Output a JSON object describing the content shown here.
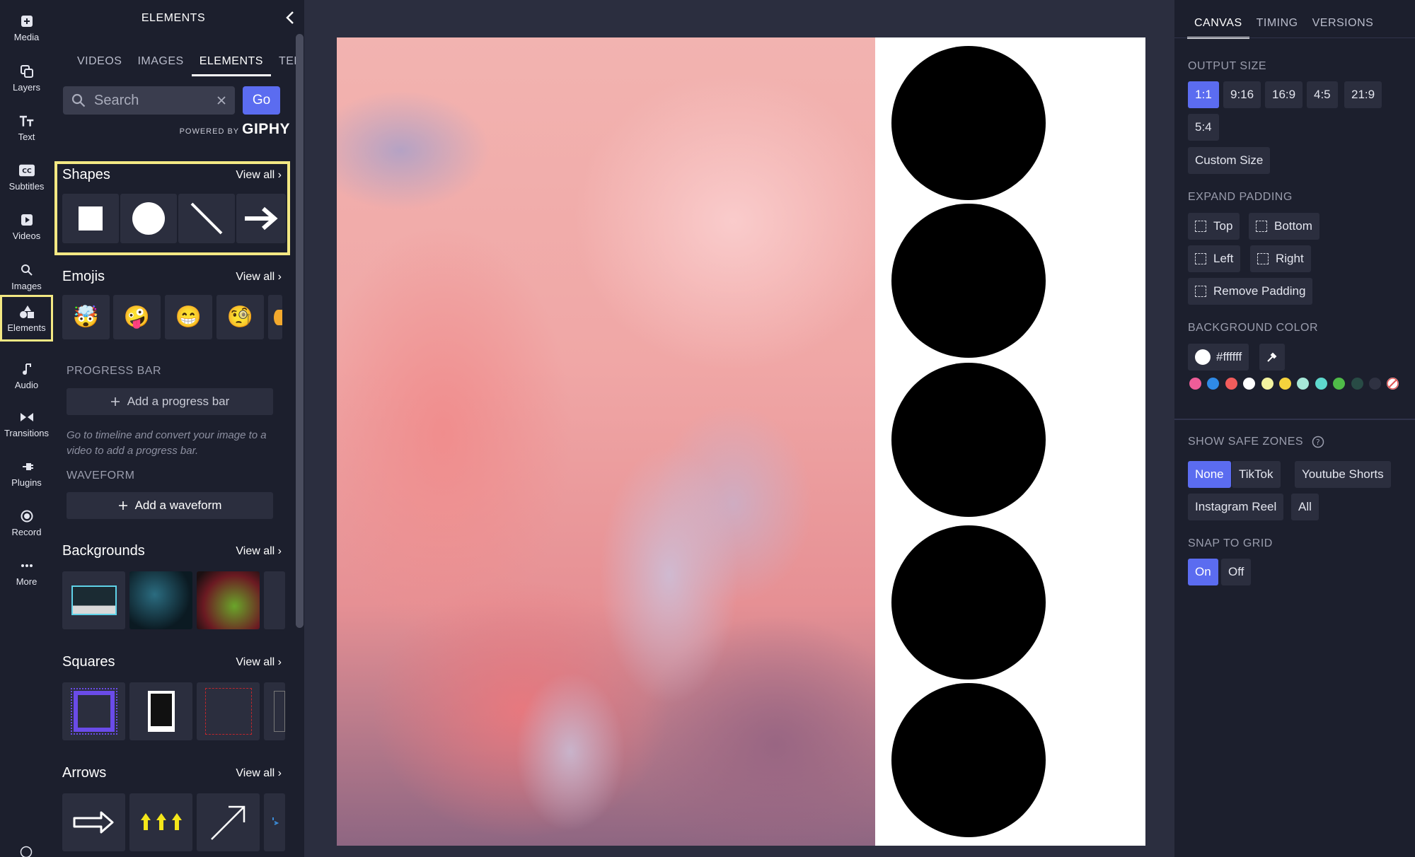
{
  "rail": {
    "items": [
      {
        "label": "Media",
        "icon": "media-icon"
      },
      {
        "label": "Layers",
        "icon": "layers-icon"
      },
      {
        "label": "Text",
        "icon": "text-icon"
      },
      {
        "label": "Subtitles",
        "icon": "subtitles-icon"
      },
      {
        "label": "Videos",
        "icon": "videos-icon"
      },
      {
        "label": "Images",
        "icon": "images-icon"
      },
      {
        "label": "Elements",
        "icon": "elements-icon",
        "active": true
      },
      {
        "label": "Audio",
        "icon": "audio-icon"
      },
      {
        "label": "Transitions",
        "icon": "transitions-icon"
      },
      {
        "label": "Plugins",
        "icon": "plugins-icon"
      },
      {
        "label": "Record",
        "icon": "record-icon"
      },
      {
        "label": "More",
        "icon": "more-icon"
      }
    ]
  },
  "panel": {
    "title": "ELEMENTS",
    "tabs": [
      "VIDEOS",
      "IMAGES",
      "ELEMENTS",
      "TEM"
    ],
    "active_tab": "ELEMENTS",
    "search_placeholder": "Search",
    "go_label": "Go",
    "powered_by": "POWERED BY",
    "giphy": "GIPHY",
    "shapes": {
      "title": "Shapes",
      "view_all": "View all ›"
    },
    "emojis": {
      "title": "Emojis",
      "view_all": "View all ›",
      "items": [
        "🤯",
        "🤪",
        "😁",
        "🧐"
      ]
    },
    "progress_bar": {
      "label": "PROGRESS BAR",
      "button": "Add a progress bar",
      "help": "Go to timeline and convert your image to a video to add a progress bar."
    },
    "waveform": {
      "label": "WAVEFORM",
      "button": "Add a waveform"
    },
    "backgrounds": {
      "title": "Backgrounds",
      "view_all": "View all ›"
    },
    "squares": {
      "title": "Squares",
      "view_all": "View all ›"
    },
    "arrows": {
      "title": "Arrows",
      "view_all": "View all ›"
    }
  },
  "right": {
    "tabs": [
      "CANVAS",
      "TIMING",
      "VERSIONS"
    ],
    "active_tab": "CANVAS",
    "output_size": {
      "label": "OUTPUT SIZE",
      "options": [
        "1:1",
        "9:16",
        "16:9",
        "4:5",
        "21:9",
        "5:4"
      ],
      "selected": "1:1",
      "custom": "Custom Size"
    },
    "expand_padding": {
      "label": "EXPAND PADDING",
      "top": "Top",
      "bottom": "Bottom",
      "left": "Left",
      "right": "Right",
      "remove": "Remove Padding"
    },
    "background_color": {
      "label": "BACKGROUND COLOR",
      "value": "#ffffff",
      "swatches": [
        "#ee5d98",
        "#2f8ae6",
        "#f25c5c",
        "#ffffff",
        "#f3f3a0",
        "#f5d33d",
        "#a6e8d8",
        "#5ed8cd",
        "#4fbb48",
        "#284b45",
        "#2f3242"
      ]
    },
    "safe_zones": {
      "label": "SHOW SAFE ZONES",
      "options": [
        "None",
        "TikTok",
        "Youtube Shorts",
        "Instagram Reel",
        "All"
      ],
      "selected": "None"
    },
    "snap_to_grid": {
      "label": "SNAP TO GRID",
      "options": [
        "On",
        "Off"
      ],
      "selected": "On"
    }
  }
}
